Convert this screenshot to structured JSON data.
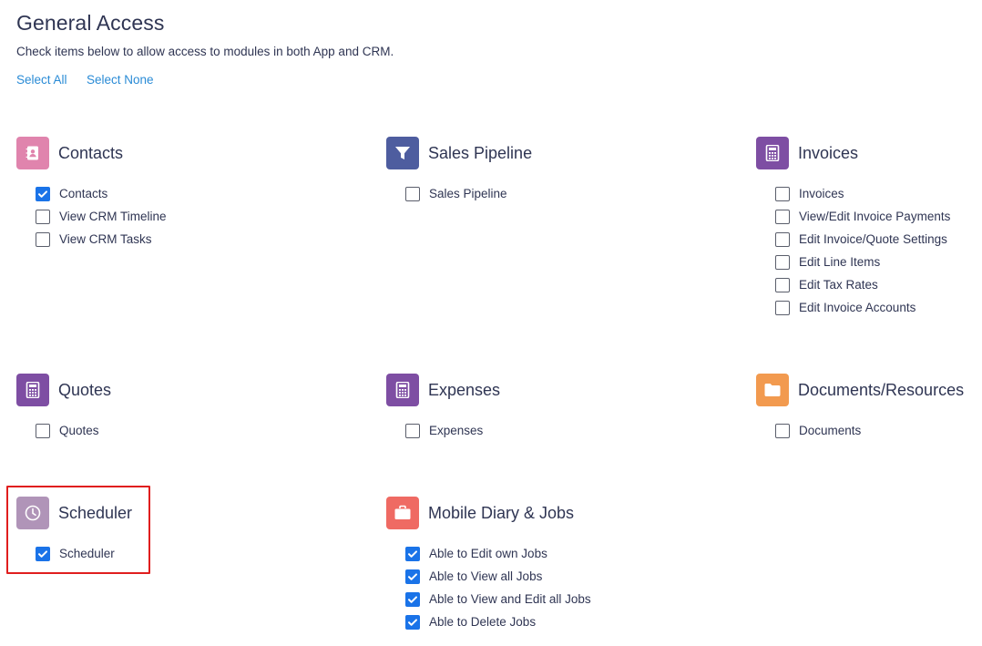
{
  "header": {
    "title": "General Access",
    "subtitle": "Check items below to allow access to modules in both App and CRM.",
    "select_all": "Select All",
    "select_none": "Select None"
  },
  "colors": {
    "contacts": "#e084ad",
    "sales_pipeline": "#4e5d9f",
    "invoices": "#7e4ea3",
    "quotes": "#7e4ea3",
    "expenses": "#7e4ea3",
    "documents": "#f29a4f",
    "scheduler": "#b094b8",
    "mobile_diary": "#ef6a63",
    "checkbox_checked": "#1a73e8",
    "link": "#2a8bd6",
    "highlight": "#e01e1e"
  },
  "sections": {
    "contacts": {
      "title": "Contacts",
      "icon": "contact-card-icon",
      "items": [
        {
          "label": "Contacts",
          "checked": true
        },
        {
          "label": "View CRM Timeline",
          "checked": false
        },
        {
          "label": "View CRM Tasks",
          "checked": false
        }
      ]
    },
    "sales_pipeline": {
      "title": "Sales Pipeline",
      "icon": "funnel-icon",
      "items": [
        {
          "label": "Sales Pipeline",
          "checked": false
        }
      ]
    },
    "invoices": {
      "title": "Invoices",
      "icon": "calculator-icon",
      "items": [
        {
          "label": "Invoices",
          "checked": false
        },
        {
          "label": "View/Edit Invoice Payments",
          "checked": false
        },
        {
          "label": "Edit Invoice/Quote Settings",
          "checked": false
        },
        {
          "label": "Edit Line Items",
          "checked": false
        },
        {
          "label": "Edit Tax Rates",
          "checked": false
        },
        {
          "label": "Edit Invoice Accounts",
          "checked": false
        }
      ]
    },
    "quotes": {
      "title": "Quotes",
      "icon": "calculator-icon",
      "items": [
        {
          "label": "Quotes",
          "checked": false
        }
      ]
    },
    "expenses": {
      "title": "Expenses",
      "icon": "calculator-icon",
      "items": [
        {
          "label": "Expenses",
          "checked": false
        }
      ]
    },
    "documents": {
      "title": "Documents/Resources",
      "icon": "folder-icon",
      "items": [
        {
          "label": "Documents",
          "checked": false
        }
      ]
    },
    "scheduler": {
      "title": "Scheduler",
      "icon": "clock-icon",
      "items": [
        {
          "label": "Scheduler",
          "checked": true
        }
      ]
    },
    "mobile_diary": {
      "title": "Mobile Diary & Jobs",
      "icon": "briefcase-icon",
      "items": [
        {
          "label": "Able to Edit own Jobs",
          "checked": true
        },
        {
          "label": "Able to View all Jobs",
          "checked": true
        },
        {
          "label": "Able to View and Edit all Jobs",
          "checked": true
        },
        {
          "label": "Able to Delete Jobs",
          "checked": true
        }
      ]
    }
  }
}
